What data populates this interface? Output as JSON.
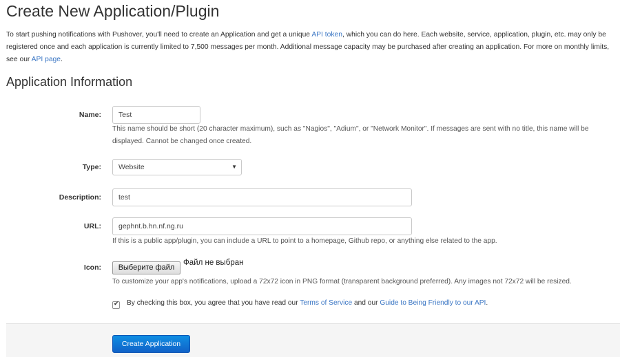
{
  "page": {
    "title": "Create New Application/Plugin",
    "intro": {
      "part1": "To start pushing notifications with Pushover, you'll need to create an Application and get a unique ",
      "api_token_link": "API token",
      "part2": ", which you can do here. Each website, service, application, plugin, etc. may only be registered once and each application is currently limited to 7,500 messages per month. Additional message capacity may be purchased after creating an application. For more on monthly limits, see our ",
      "api_page_link": "API page",
      "part3": "."
    },
    "section_title": "Application Information"
  },
  "form": {
    "name": {
      "label": "Name:",
      "value": "Test",
      "help": "This name should be short (20 character maximum), such as \"Nagios\", \"Adium\", or \"Network Monitor\". If messages are sent with no title, this name will be displayed. Cannot be changed once created."
    },
    "type": {
      "label": "Type:",
      "value": "Website",
      "arrow": "▼"
    },
    "description": {
      "label": "Description:",
      "value": "test"
    },
    "url": {
      "label": "URL:",
      "value": "gephnt.b.hn.nf.ng.ru",
      "help": "If this is a public app/plugin, you can include a URL to point to a homepage, Github repo, or anything else related to the app."
    },
    "icon": {
      "label": "Icon:",
      "button_label": "Выберите файл",
      "status": "Файл не выбран",
      "help": "To customize your app's notifications, upload a 72x72 icon in PNG format (transparent background preferred). Any images not 72x72 will be resized."
    },
    "agreement": {
      "checked": true,
      "check_glyph": "✔",
      "text1": "By checking this box, you agree that you have read our ",
      "terms_link": "Terms of Service",
      "text2": " and our ",
      "guide_link": "Guide to Being Friendly to our API",
      "text3": "."
    },
    "submit_label": "Create Application"
  },
  "colors": {
    "link": "#3a76c4",
    "primary_button": "#1162c8",
    "footer_background": "#f5f5f5"
  }
}
